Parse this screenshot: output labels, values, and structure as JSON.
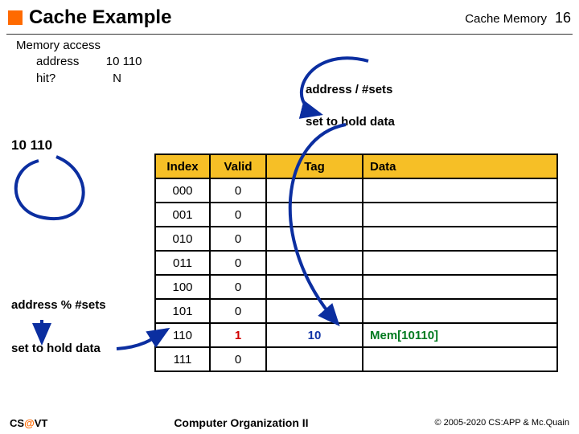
{
  "header": {
    "title": "Cache Example",
    "section": "Cache Memory",
    "slide_number": "16"
  },
  "mem_access": {
    "line1": "Memory access",
    "address_label": "address",
    "address_value": "10 110",
    "hit_label": "hit?",
    "hit_value": "N"
  },
  "labels": {
    "addr_div_sets": "address / #sets",
    "set_hold_top": "set to hold data",
    "bits": "10 110",
    "addr_mod_sets": "address % #sets",
    "set_hold_left": "set to hold data"
  },
  "table": {
    "headers": {
      "index": "Index",
      "valid": "Valid",
      "tag": "Tag",
      "data": "Data"
    },
    "rows": [
      {
        "index": "000",
        "valid": "0",
        "tag": "",
        "data": ""
      },
      {
        "index": "001",
        "valid": "0",
        "tag": "",
        "data": ""
      },
      {
        "index": "010",
        "valid": "0",
        "tag": "",
        "data": ""
      },
      {
        "index": "011",
        "valid": "0",
        "tag": "",
        "data": ""
      },
      {
        "index": "100",
        "valid": "0",
        "tag": "",
        "data": ""
      },
      {
        "index": "101",
        "valid": "0",
        "tag": "",
        "data": ""
      },
      {
        "index": "110",
        "valid": "1",
        "tag": "10",
        "data": "Mem[10110]",
        "highlight": true
      },
      {
        "index": "111",
        "valid": "0",
        "tag": "",
        "data": ""
      }
    ]
  },
  "footer": {
    "cs": "CS",
    "at": "@",
    "vt": "VT",
    "course": "Computer Organization II",
    "copyright": "© 2005-2020 CS:APP & Mc.Quain"
  }
}
